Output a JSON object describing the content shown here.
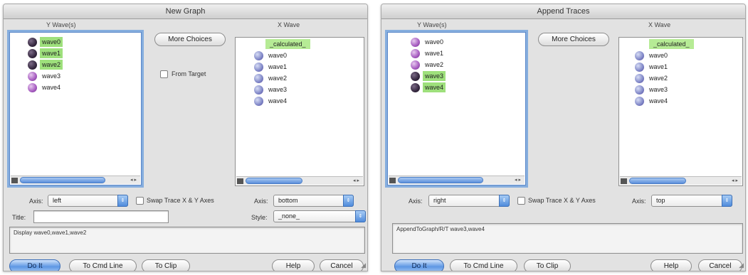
{
  "new_graph": {
    "title": "New Graph",
    "y_header": "Y Wave(s)",
    "x_header": "X Wave",
    "y_waves": [
      {
        "name": "wave0",
        "selected": true
      },
      {
        "name": "wave1",
        "selected": true
      },
      {
        "name": "wave2",
        "selected": true
      },
      {
        "name": "wave3",
        "selected": false
      },
      {
        "name": "wave4",
        "selected": false
      }
    ],
    "x_calculated": "_calculated_",
    "x_waves": [
      "wave0",
      "wave1",
      "wave2",
      "wave3",
      "wave4"
    ],
    "more_choices": "More Choices",
    "from_target": "From Target",
    "axis_label": "Axis:",
    "axis_value": "left",
    "swap_label": "Swap Trace X & Y Axes",
    "x_axis_label": "Axis:",
    "x_axis_value": "bottom",
    "title_label": "Title:",
    "title_value": "",
    "style_label": "Style:",
    "style_value": "_none_",
    "command": "Display wave0,wave1,wave2",
    "do_it": "Do It",
    "to_cmd_line": "To Cmd Line",
    "to_clip": "To Clip",
    "help": "Help",
    "cancel": "Cancel"
  },
  "append_traces": {
    "title": "Append Traces",
    "y_header": "Y Wave(s)",
    "x_header": "X Wave",
    "y_waves": [
      {
        "name": "wave0",
        "selected": false
      },
      {
        "name": "wave1",
        "selected": false
      },
      {
        "name": "wave2",
        "selected": false
      },
      {
        "name": "wave3",
        "selected": true
      },
      {
        "name": "wave4",
        "selected": true
      }
    ],
    "x_calculated": "_calculated_",
    "x_waves": [
      "wave0",
      "wave1",
      "wave2",
      "wave3",
      "wave4"
    ],
    "more_choices": "More Choices",
    "axis_label": "Axis:",
    "axis_value": "right",
    "swap_label": "Swap Trace X & Y Axes",
    "x_axis_label": "Axis:",
    "x_axis_value": "top",
    "command": "AppendToGraph/R/T wave3,wave4",
    "do_it": "Do It",
    "to_cmd_line": "To Cmd Line",
    "to_clip": "To Clip",
    "help": "Help",
    "cancel": "Cancel"
  }
}
